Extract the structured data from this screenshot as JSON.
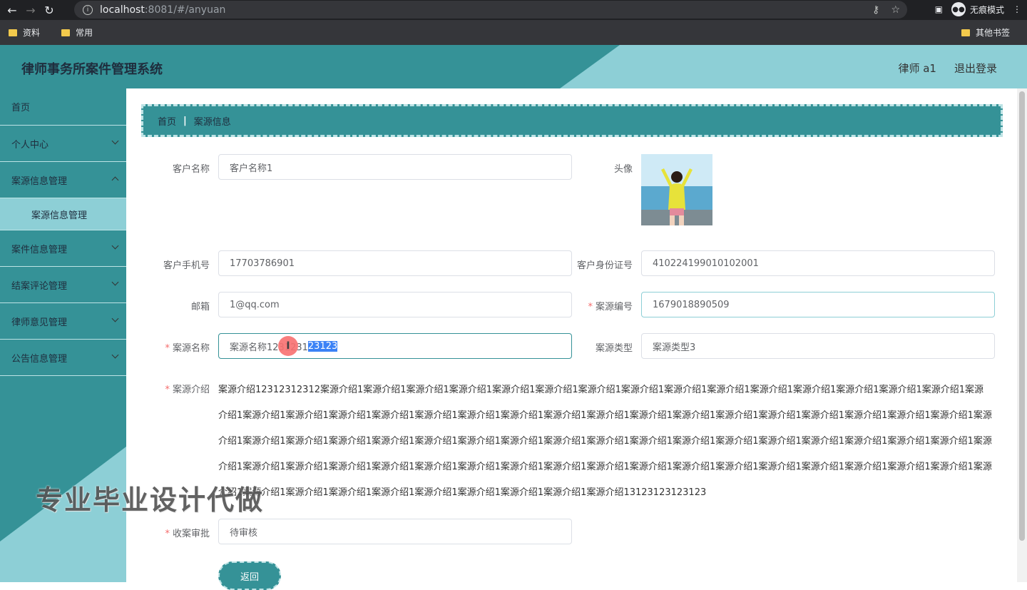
{
  "browser": {
    "url_host": "localhost",
    "url_rest": ":8081/#/anyuan",
    "incognito_label": "无痕模式",
    "bookmarks": [
      "资料",
      "常用"
    ],
    "other_bookmarks": "其他书签"
  },
  "header": {
    "title": "律师事务所案件管理系统",
    "user": "律师 a1",
    "logout": "退出登录"
  },
  "sidebar": {
    "items": [
      {
        "label": "首页"
      },
      {
        "label": "个人中心"
      },
      {
        "label": "案源信息管理"
      },
      {
        "label": "案源信息管理"
      },
      {
        "label": "案件信息管理"
      },
      {
        "label": "结案评论管理"
      },
      {
        "label": "律师意见管理"
      },
      {
        "label": "公告信息管理"
      }
    ]
  },
  "breadcrumb": {
    "home": "首页",
    "sep": "|",
    "current": "案源信息"
  },
  "form": {
    "customer_name_label": "客户名称",
    "customer_name": "客户名称1",
    "avatar_label": "头像",
    "phone_label": "客户手机号",
    "phone": "17703786901",
    "idcard_label": "客户身份证号",
    "idcard": "410224199010102001",
    "email_label": "邮箱",
    "email": "1@qq.com",
    "code_label": "案源编号",
    "code": "1679018890509",
    "name_label": "案源名称",
    "name_before": "案源名称1231231",
    "name_selected": "23123",
    "type_label": "案源类型",
    "type": "案源类型3",
    "intro_label": "案源介绍",
    "intro": "案源介绍12312312312案源介绍1案源介绍1案源介绍1案源介绍1案源介绍1案源介绍1案源介绍1案源介绍1案源介绍1案源介绍1案源介绍1案源介绍1案源介绍1案源介绍1案源介绍1案源介绍1案源介绍1案源介绍1案源介绍1案源介绍1案源介绍1案源介绍1案源介绍1案源介绍1案源介绍1案源介绍1案源介绍1案源介绍1案源介绍1案源介绍1案源介绍1案源介绍1案源介绍1案源介绍1案源介绍1案源介绍1案源介绍1案源介绍1案源介绍1案源介绍1案源介绍1案源介绍1案源介绍1案源介绍1案源介绍1案源介绍1案源介绍1案源介绍1案源介绍1案源介绍1案源介绍1案源介绍1案源介绍1案源介绍1案源介绍1案源介绍1案源介绍1案源介绍1案源介绍1案源介绍1案源介绍1案源介绍1案源介绍1案源介绍1案源介绍1案源介绍1案源介绍1案源介绍1案源介绍1案源介绍1案源介绍1案源介绍1案源介绍1案源介绍1案源介绍1案源介绍1案源介绍1案源介绍1案源介绍13123123123123",
    "approval_label": "收案审批",
    "approval": "待审核",
    "back_label": "返回"
  },
  "watermark": "专业毕业设计代做",
  "colors": {
    "primary": "#359297",
    "light": "#8dcfd6",
    "border_light": "#bde3e5",
    "required": "#f56c6c"
  }
}
